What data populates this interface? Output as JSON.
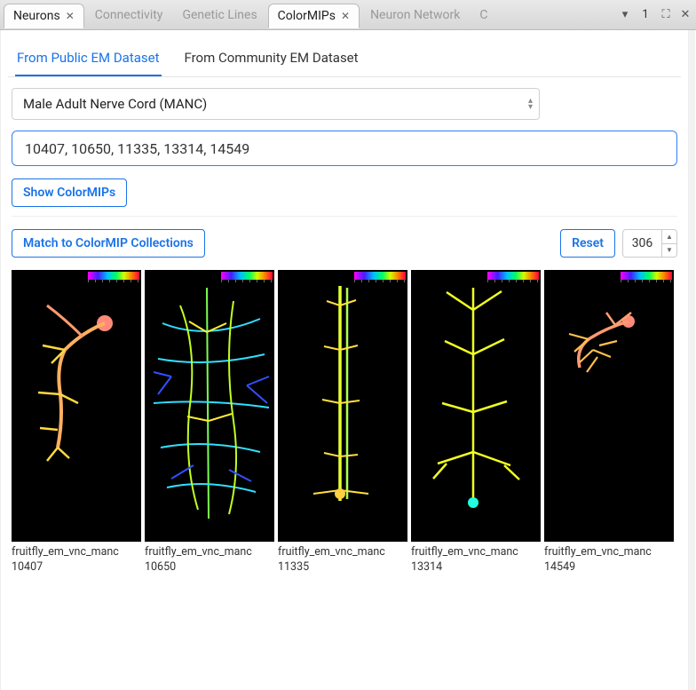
{
  "tabs": [
    {
      "label": "Neurons",
      "active": true,
      "closable": true
    },
    {
      "label": "Connectivity",
      "active": false,
      "closable": false
    },
    {
      "label": "Genetic Lines",
      "active": false,
      "closable": false
    },
    {
      "label": "ColorMIPs",
      "active": true,
      "closable": true
    },
    {
      "label": "Neuron Network",
      "active": false,
      "closable": false
    }
  ],
  "overflow_tab_letter": "C",
  "tabbar_number": "1",
  "subtabs": {
    "public": "From Public EM Dataset",
    "community": "From Community EM Dataset"
  },
  "dataset_select": {
    "value": "Male Adult Nerve Cord (MANC)"
  },
  "id_input": {
    "value": "10407, 10650, 11335, 13314, 14549"
  },
  "buttons": {
    "show": "Show ColorMIPs",
    "match": "Match to ColorMIP Collections",
    "reset": "Reset"
  },
  "size_input": {
    "value": "306"
  },
  "results": [
    {
      "name": "fruitfly_em_vnc_manc",
      "id": "10407"
    },
    {
      "name": "fruitfly_em_vnc_manc",
      "id": "10650"
    },
    {
      "name": "fruitfly_em_vnc_manc",
      "id": "11335"
    },
    {
      "name": "fruitfly_em_vnc_manc",
      "id": "13314"
    },
    {
      "name": "fruitfly_em_vnc_manc",
      "id": "14549"
    }
  ]
}
